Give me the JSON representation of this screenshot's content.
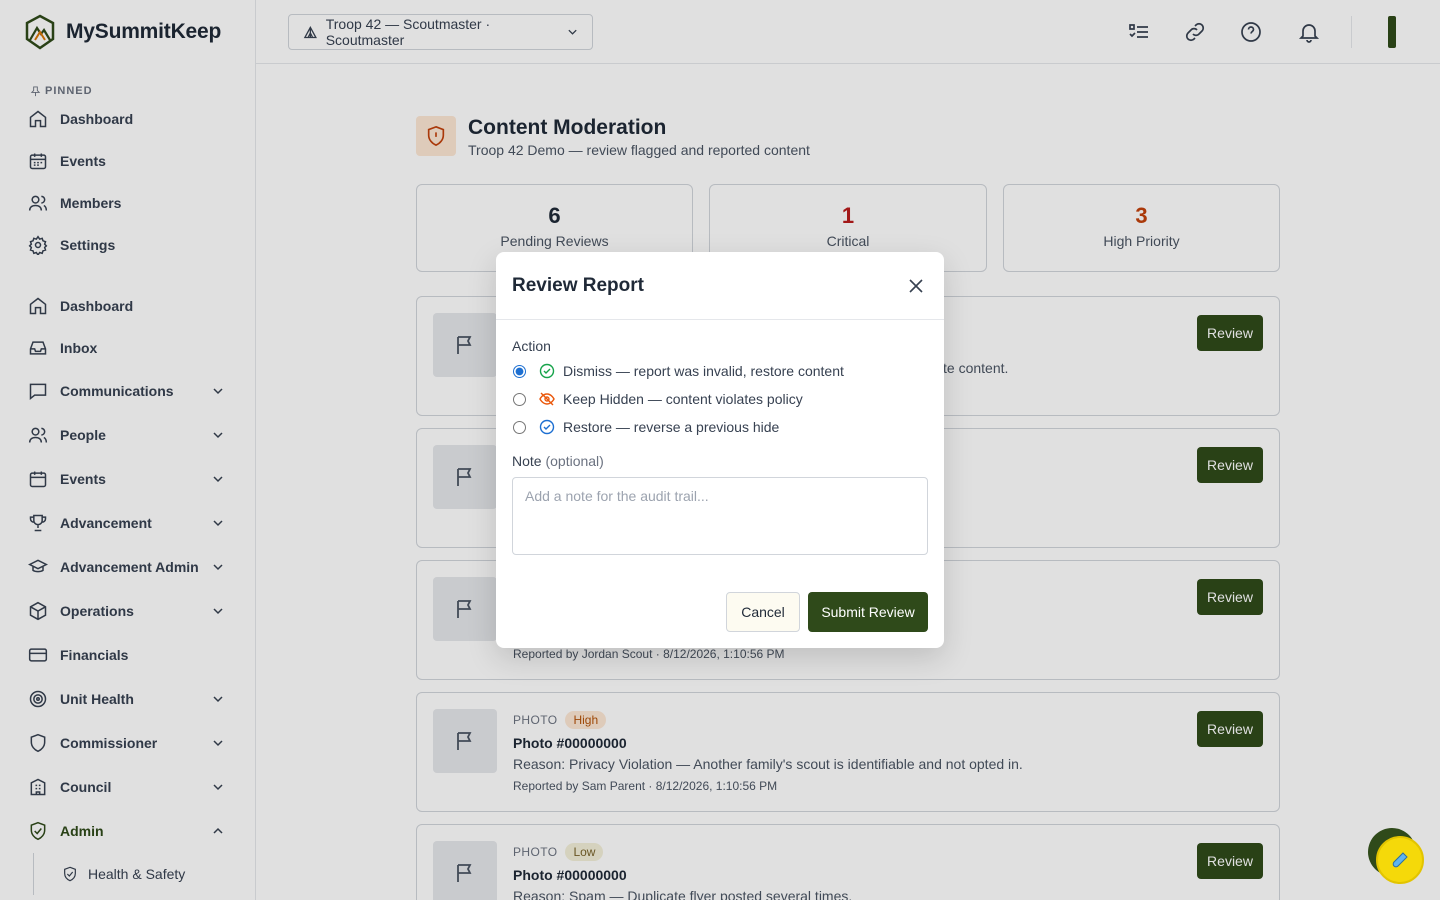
{
  "brand": {
    "name": "MySummitKeep"
  },
  "sidebar": {
    "pinned_label": "PINNED",
    "pinned": [
      {
        "label": "Dashboard",
        "icon": "home-icon"
      },
      {
        "label": "Events",
        "icon": "calendar-icon"
      },
      {
        "label": "Members",
        "icon": "users-icon"
      },
      {
        "label": "Settings",
        "icon": "gear-icon"
      }
    ],
    "items": [
      {
        "label": "Dashboard",
        "icon": "home-icon"
      },
      {
        "label": "Inbox",
        "icon": "inbox-icon"
      },
      {
        "label": "Communications",
        "icon": "message-icon",
        "expandable": true
      },
      {
        "label": "People",
        "icon": "users-icon",
        "expandable": true
      },
      {
        "label": "Events",
        "icon": "calendar-icon",
        "expandable": true
      },
      {
        "label": "Advancement",
        "icon": "trophy-icon",
        "expandable": true
      },
      {
        "label": "Advancement Admin",
        "icon": "graduation-cap-icon",
        "expandable": true
      },
      {
        "label": "Operations",
        "icon": "box-icon",
        "expandable": true
      },
      {
        "label": "Financials",
        "icon": "credit-card-icon"
      },
      {
        "label": "Unit Health",
        "icon": "target-icon",
        "expandable": true
      },
      {
        "label": "Commissioner",
        "icon": "shield-icon",
        "expandable": true
      },
      {
        "label": "Council",
        "icon": "building-icon",
        "expandable": true
      },
      {
        "label": "Admin",
        "icon": "shield-check-icon",
        "expandable": true,
        "expanded": true
      }
    ],
    "sub_items": [
      {
        "label": "Health & Safety",
        "icon": "shield-icon"
      }
    ]
  },
  "header": {
    "troop_selector": "Troop 42 — Scoutmaster · Scoutmaster"
  },
  "page": {
    "title": "Content Moderation",
    "subtitle": "Troop 42 Demo — review flagged and reported content"
  },
  "stats": [
    {
      "value": "6",
      "label": "Pending Reviews",
      "color": "#1f2937"
    },
    {
      "value": "1",
      "label": "Critical",
      "color": "#b91c1c"
    },
    {
      "value": "3",
      "label": "High Priority",
      "color": "#c2410c"
    }
  ],
  "reports": {
    "review_label": "Review",
    "partial_reason_1": "te content.",
    "partial_reporter_3": "Reported by Jordan Scout · 8/12/2026, 1:10:56 PM",
    "card4": {
      "type": "PHOTO",
      "priority": "High",
      "title": "Photo #00000000",
      "reason": "Reason: Privacy Violation — Another family's scout is identifiable and not opted in.",
      "reporter": "Reported by Sam Parent · 8/12/2026, 1:10:56 PM"
    },
    "card5": {
      "type": "PHOTO",
      "priority": "Low",
      "title": "Photo #00000000",
      "reason": "Reason: Spam — Duplicate flyer posted several times."
    }
  },
  "modal": {
    "title": "Review Report",
    "action_label": "Action",
    "options": [
      {
        "label": "Dismiss — report was invalid, restore content",
        "checked": true,
        "icon": "check-circle-icon",
        "color": "#16a34a"
      },
      {
        "label": "Keep Hidden — content violates policy",
        "checked": false,
        "icon": "eye-off-icon",
        "color": "#ea580c"
      },
      {
        "label": "Restore — reverse a previous hide",
        "checked": false,
        "icon": "check-circle-icon",
        "color": "#1d6fd1"
      }
    ],
    "note_label": "Note",
    "note_optional": "(optional)",
    "note_placeholder": "Add a note for the audit trail...",
    "cancel_label": "Cancel",
    "submit_label": "Submit Review"
  },
  "fab": {
    "icon": "test-tube-icon"
  }
}
